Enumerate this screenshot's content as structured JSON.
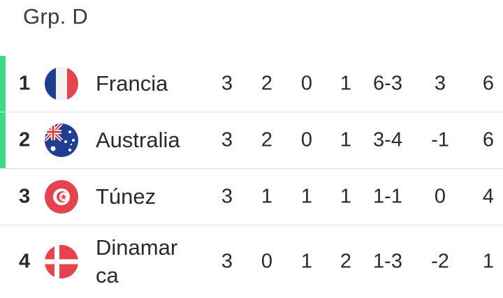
{
  "group": {
    "title": "Grp. D"
  },
  "colors": {
    "qualified": "#3ddc84"
  },
  "standings": [
    {
      "pos": "1",
      "team_line1": "Francia",
      "team_line2": "",
      "flag": "france-flag-icon",
      "qualified": true,
      "pj": "3",
      "g": "2",
      "e": "0",
      "p": "1",
      "goals": "6-3",
      "dif": "3",
      "pts": "6"
    },
    {
      "pos": "2",
      "team_line1": "Australia",
      "team_line2": "",
      "flag": "australia-flag-icon",
      "qualified": true,
      "pj": "3",
      "g": "2",
      "e": "0",
      "p": "1",
      "goals": "3-4",
      "dif": "-1",
      "pts": "6"
    },
    {
      "pos": "3",
      "team_line1": "Túnez",
      "team_line2": "",
      "flag": "tunisia-flag-icon",
      "qualified": false,
      "pj": "3",
      "g": "1",
      "e": "1",
      "p": "1",
      "goals": "1-1",
      "dif": "0",
      "pts": "4"
    },
    {
      "pos": "4",
      "team_line1": "Dinamar",
      "team_line2": "ca",
      "flag": "denmark-flag-icon",
      "qualified": false,
      "pj": "3",
      "g": "0",
      "e": "1",
      "p": "2",
      "goals": "1-3",
      "dif": "-2",
      "pts": "1"
    }
  ]
}
